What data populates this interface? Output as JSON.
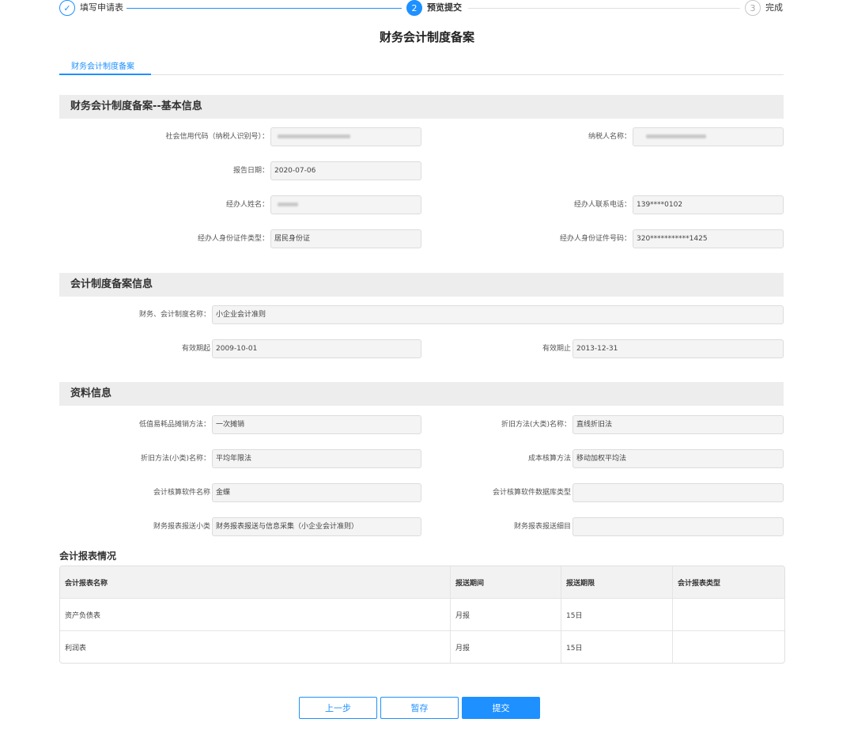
{
  "steps": [
    {
      "num": "✓",
      "label": "填写申请表",
      "state": "done"
    },
    {
      "num": "2",
      "label": "预览提交",
      "state": "active"
    },
    {
      "num": "3",
      "label": "完成",
      "state": "todo"
    }
  ],
  "page_title": "财务会计制度备案",
  "tab_label": "财务会计制度备案",
  "basic": {
    "title": "财务会计制度备案--基本信息",
    "credit_code_label": "社会信用代码（纳税人识别号）：",
    "taxpayer_name_label": "纳税人名称：",
    "report_date_label": "报告日期：",
    "report_date": "2020-07-06",
    "agent_name_label": "经办人姓名：",
    "agent_phone_label": "经办人联系电话：",
    "agent_phone": "139****0102",
    "id_type_label": "经办人身份证件类型：",
    "id_type": "居民身份证",
    "id_no_label": "经办人身份证件号码：",
    "id_no": "320***********1425"
  },
  "system": {
    "title": "会计制度备案信息",
    "name_label": "财务、会计制度名称：",
    "name": "小企业会计准则",
    "start_label": "有效期起",
    "start": "2009-10-01",
    "end_label": "有效期止",
    "end": "2013-12-31"
  },
  "materials": {
    "title": "资料信息",
    "low_value_label": "低值易耗品摊销方法：",
    "low_value": "一次摊销",
    "dep_major_label": "折旧方法(大类)名称：",
    "dep_major": "直线折旧法",
    "dep_minor_label": "折旧方法(小类)名称：",
    "dep_minor": "平均年限法",
    "cost_label": "成本核算方法",
    "cost": "移动加权平均法",
    "software_label": "会计核算软件名称",
    "software": "金蝶",
    "db_type_label": "会计核算软件数据库类型",
    "db_type": "",
    "report_sub_label": "财务报表报送小类",
    "report_sub": "财务报表报送与信息采集（小企业会计准则）",
    "report_item_label": "财务报表报送细目",
    "report_item": ""
  },
  "reports": {
    "title": "会计报表情况",
    "headers": [
      "会计报表名称",
      "报送期间",
      "报送期限",
      "会计报表类型"
    ],
    "rows": [
      [
        "资产负债表",
        "月报",
        "15日",
        ""
      ],
      [
        "利润表",
        "月报",
        "15日",
        ""
      ]
    ]
  },
  "buttons": {
    "prev": "上一步",
    "save": "暂存",
    "submit": "提交"
  },
  "colors": {
    "accent": "#1e90ff",
    "section_bg": "#ededed",
    "field_bg": "#f4f4f4"
  }
}
